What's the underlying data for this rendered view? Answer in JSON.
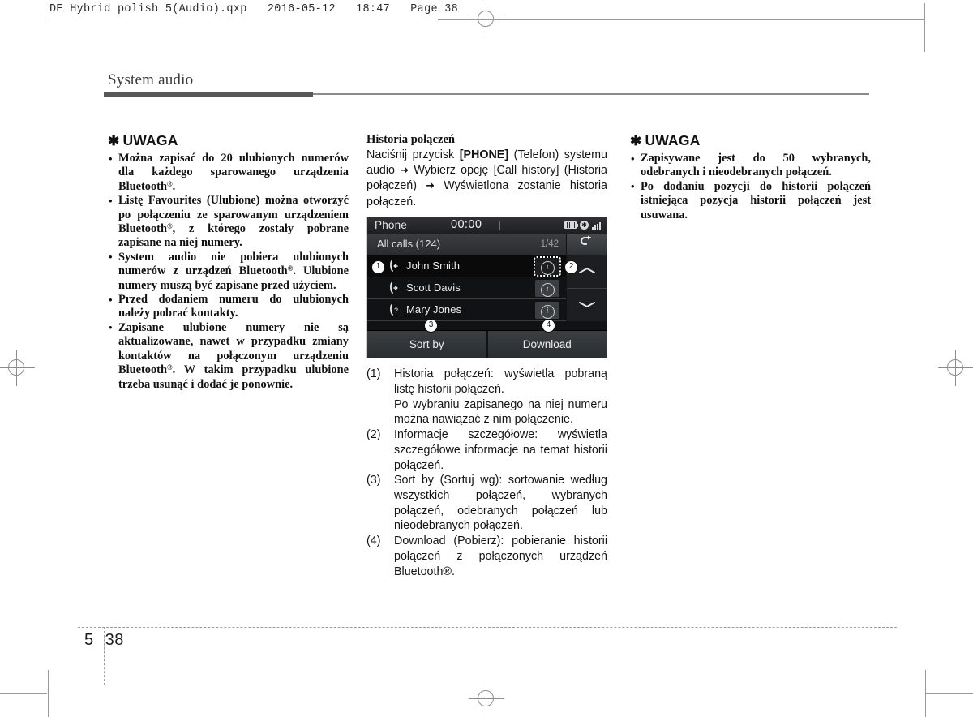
{
  "file_header": "DE Hybrid polish 5(Audio).qxp   2016-05-12   18:47   Page 38",
  "running_head": "System audio",
  "footer": {
    "section": "5",
    "page": "38"
  },
  "left_note": {
    "symbol": "✱",
    "title": "UWAGA",
    "items": [
      "Można zapisać do 20 ulubionych numerów dla każdego sparowanego urządzenia Bluetooth®.",
      "Listę Favourites (Ulubione) można otworzyć po połączeniu ze sparowanym urządzeniem Bluetooth®, z którego zostały pobrane zapisane na niej numery.",
      "System audio nie pobiera ulubionych numerów z urządzeń Bluetooth®. Ulubione numery muszą być zapisane przed użyciem.",
      "Przed dodaniem numeru do ulubionych należy pobrać kontakty.",
      "Zapisane ulubione numery nie są aktualizowane, nawet w przypadku zmiany kontaktów na połączonym urządzeniu Bluetooth®. W takim przypadku ulubione trzeba usunąć i dodać je ponownie."
    ]
  },
  "middle": {
    "section_title": "Historia połączeń",
    "intro_parts": {
      "p1": "Naciśnij przycisk ",
      "b1": "[PHONE]",
      "p2": " (Telefon) systemu audio ",
      "arrow1": "➜",
      "p3": " Wybierz opcję [Call history] (Historia połączeń) ",
      "arrow2": "➜",
      "p4": " Wyświetlona zostanie historia połączeń."
    },
    "numbered_items": [
      {
        "marker": "(1)",
        "paragraphs": [
          "Historia połączeń: wyświetla pobraną listę historii połączeń.",
          "Po wybraniu zapisanego na niej numeru można nawiązać z nim połączenie."
        ]
      },
      {
        "marker": "(2)",
        "paragraphs": [
          "Informacje szczegółowe: wyświetla szczegółowe informacje na temat historii połączeń."
        ]
      },
      {
        "marker": "(3)",
        "paragraphs": [
          "Sort by (Sortuj wg): sortowanie według wszystkich połączeń, wybranych połączeń, odebranych połączeń lub nieodebranych połączeń."
        ]
      },
      {
        "marker": "(4)",
        "paragraphs": [
          "Download (Pobierz): pobieranie historii połączeń z połączonych urządzeń Bluetooth®."
        ]
      }
    ]
  },
  "device": {
    "status": {
      "title": "Phone",
      "clock": "00:00",
      "icons": [
        "battery-icon",
        "bluetooth-icon",
        "signal-icon"
      ]
    },
    "subbar": {
      "label": "All calls (124)",
      "count": "1/42",
      "back_glyph": "↩"
    },
    "rows": [
      {
        "name": "John Smith",
        "call_type": "incoming",
        "info_glyph": "i",
        "selected": true
      },
      {
        "name": "Scott Davis",
        "call_type": "outgoing",
        "info_glyph": "i",
        "selected": false
      },
      {
        "name": "Mary Jones",
        "call_type": "missed",
        "info_glyph": "i",
        "selected": false
      }
    ],
    "scroll": {
      "up_glyph": "⌃",
      "down_glyph": "⌄"
    },
    "footer_buttons": [
      "Sort by",
      "Download"
    ],
    "callouts": [
      "1",
      "2",
      "3",
      "4"
    ]
  },
  "right_note": {
    "symbol": "✱",
    "title": "UWAGA",
    "items": [
      "Zapisywane jest do 50 wybranych, odebranych i nieodebranych połączeń.",
      "Po dodaniu pozycji do historii połączeń istniejąca pozycja historii połączeń jest usuwana."
    ]
  },
  "colors": {
    "rule_dark": "#58585a",
    "rule_light": "#8b8b8d",
    "device_bg": "#111214",
    "text": "#141414"
  }
}
